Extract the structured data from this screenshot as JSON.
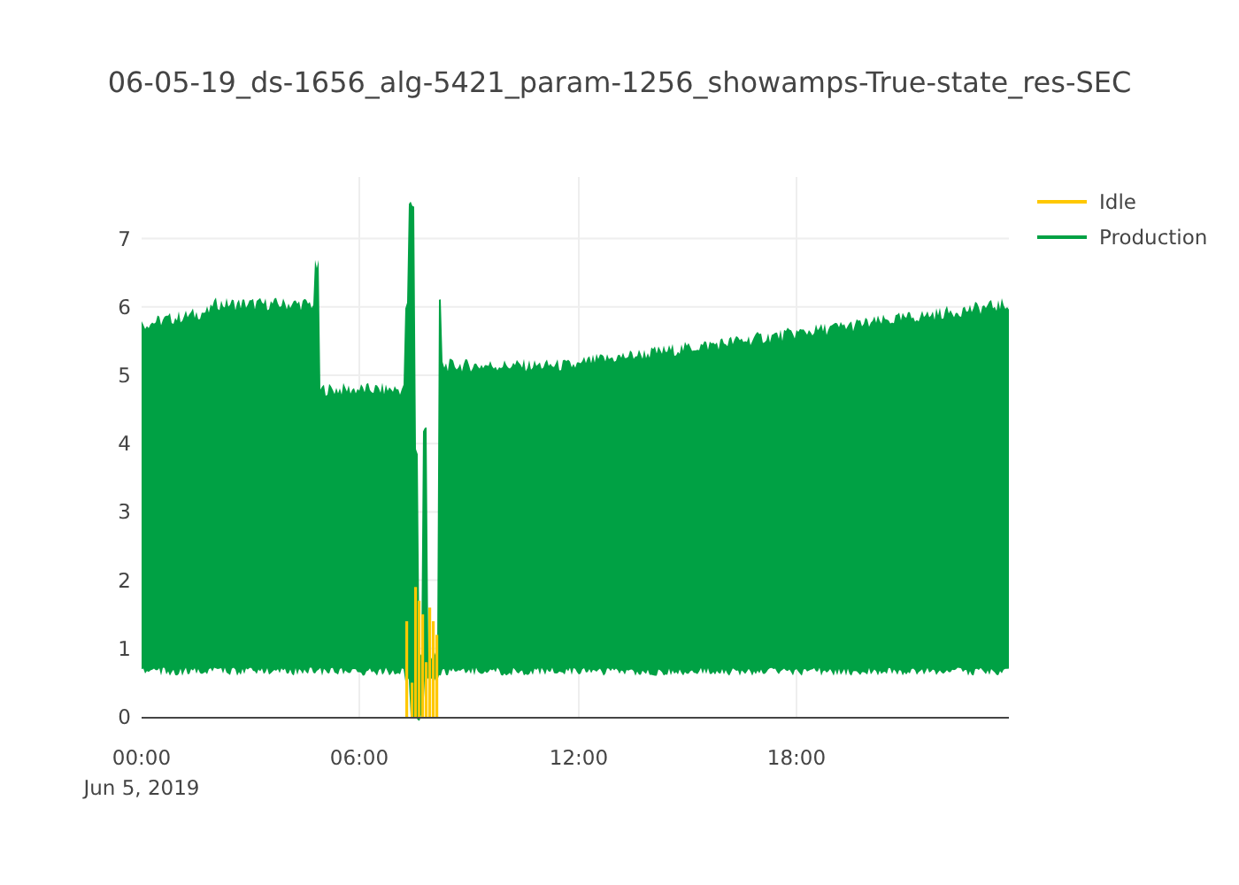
{
  "title": "06-05-19_ds-1656_alg-5421_param-1256_showamps-True-state_res-SEC",
  "legend": [
    {
      "label": "Idle",
      "color": "#ffc800"
    },
    {
      "label": "Production",
      "color": "#00a144"
    }
  ],
  "y_ticks": [
    "7",
    "6",
    "5",
    "4",
    "3",
    "2",
    "1",
    "0"
  ],
  "x_ticks": [
    "00:00",
    "06:00",
    "12:00",
    "18:00"
  ],
  "x_date": "Jun 5, 2019"
}
